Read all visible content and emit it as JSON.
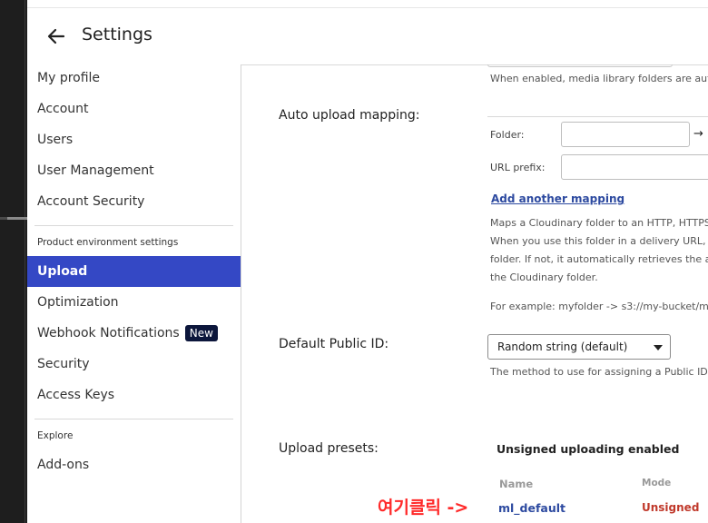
{
  "header": {
    "title": "Settings"
  },
  "sidebar": {
    "items": [
      {
        "label": "My profile"
      },
      {
        "label": "Account"
      },
      {
        "label": "Users"
      },
      {
        "label": "User Management"
      },
      {
        "label": "Account Security"
      }
    ],
    "section_product": "Product environment settings",
    "product_items": [
      {
        "label": "Upload",
        "active": true
      },
      {
        "label": "Optimization"
      },
      {
        "label": "Webhook Notifications",
        "badge": "New"
      },
      {
        "label": "Security"
      },
      {
        "label": "Access Keys"
      }
    ],
    "section_explore": "Explore",
    "explore_items": [
      {
        "label": "Add-ons"
      }
    ]
  },
  "main": {
    "top_help": "When enabled, media library folders are aut",
    "auto_upload": {
      "label": "Auto upload mapping:",
      "folder_label": "Folder:",
      "folder_value": "",
      "arrow": "→",
      "url_prefix_label": "URL prefix:",
      "url_prefix_value": "",
      "add_link": "Add another mapping",
      "help_lines": [
        "Maps a Cloudinary folder to an HTTP, HTTPS,",
        "When you use this folder in a delivery URL, C",
        "folder. If not, it automatically retrieves the a",
        "the Cloudinary folder."
      ],
      "example": "For example: myfolder -> s3://my-bucket/my"
    },
    "public_id": {
      "label": "Default Public ID:",
      "selected": "Random string (default)",
      "help": "The method to use for assigning a Public ID t"
    },
    "upload_presets": {
      "label": "Upload presets:",
      "heading": "Unsigned uploading enabled",
      "columns": [
        "Name",
        "Mode"
      ],
      "rows": [
        {
          "name": "ml_default",
          "mode": "Unsigned"
        }
      ]
    }
  },
  "annotation": "여기클릭 ->",
  "colors": {
    "accent": "#3448c5",
    "badge": "#0c163b",
    "link": "#2d4aa0",
    "unsigned": "#c0392b",
    "annotation": "#ff2a2a"
  }
}
